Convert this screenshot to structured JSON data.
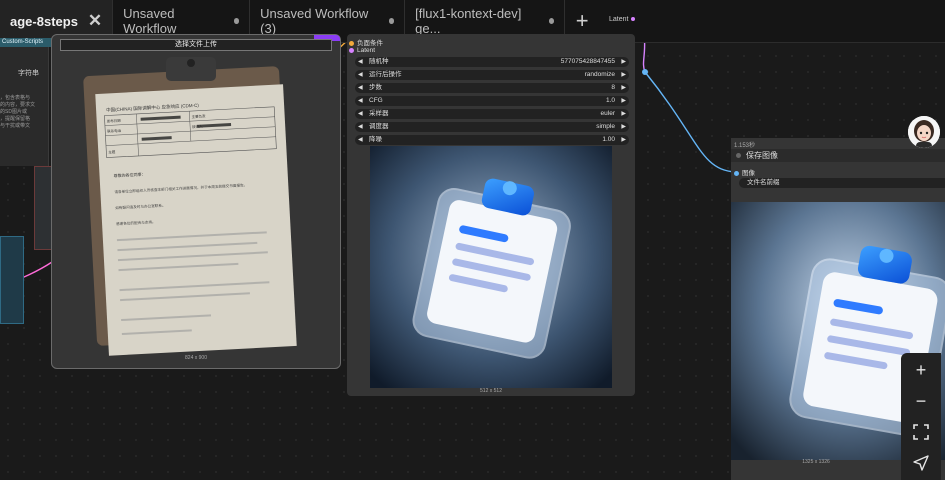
{
  "tabs": [
    {
      "label": "age-8steps",
      "active": true,
      "close_icon": "close-icon"
    },
    {
      "label": "Unsaved Workflow",
      "active": false
    },
    {
      "label": "Unsaved Workflow (3)",
      "active": false
    },
    {
      "label": "[flux1-kontext-dev] ge...",
      "active": false
    }
  ],
  "new_tab_glyph": "+",
  "top_latent_label": "Latent",
  "left_node": {
    "header": "Custom-Scripts",
    "field": "字符串",
    "text_lines": [
      "，包含表格与",
      "的内容，要求文",
      "的SD图片或",
      "，提醒保留格",
      "与干扰或带文"
    ]
  },
  "load_image": {
    "upload_label": "选择文件上传",
    "caption": "824 x 900",
    "document": {
      "header": "中国(CHINA) 国际调解中心 应急响应 (CDM-C)",
      "rows": [
        "发布日期",
        "主要负责",
        "联系电话",
        "接收人",
        "主题"
      ],
      "body": [
        "尊敬的各位同事：",
        "请各单位立即组织人员核查本部门相关工作进展情况，并于本周五前提交书面报告。",
        "如有疑问请及时与办公室联系。",
        "感谢各位的配合与支持。"
      ]
    }
  },
  "sampler": {
    "inputs": [
      {
        "label": "负面条件",
        "color": "#f2a93b"
      },
      {
        "label": "Latent",
        "color": "#d783ff"
      }
    ],
    "widgets": [
      {
        "label": "随机种",
        "value": "577075428847455"
      },
      {
        "label": "运行后操作",
        "value": "randomize"
      },
      {
        "label": "步数",
        "value": "8"
      },
      {
        "label": "CFG",
        "value": "1.0"
      },
      {
        "label": "采样器",
        "value": "euler"
      },
      {
        "label": "调度器",
        "value": "simple"
      },
      {
        "label": "降噪",
        "value": "1.00"
      }
    ],
    "caption": "512 x 512"
  },
  "save_image": {
    "time": "1.153秒",
    "title": "保存图像",
    "input_label": "图像",
    "field": "文件名前缀",
    "caption": "1325 x 1326"
  },
  "colors": {
    "accent_purple": "#8b3df5",
    "wire_blue": "#64b5f6",
    "wire_pink": "#ff6bd9",
    "latent_dot": "#d783ff",
    "neg_dot": "#f2a93b"
  },
  "toolbar": {
    "zoom_in": "+",
    "zoom_out": "−",
    "fit_icon": "fit-view-icon",
    "locate_icon": "navigate-icon"
  }
}
